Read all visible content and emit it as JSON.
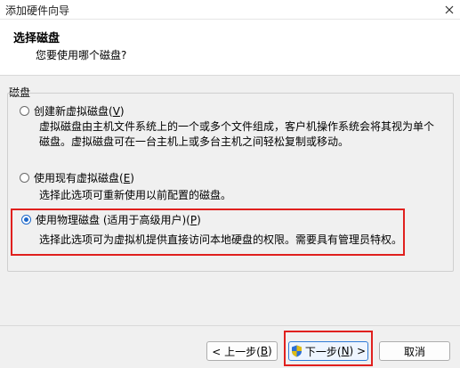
{
  "window": {
    "title": "添加硬件向导"
  },
  "header": {
    "title": "选择磁盘",
    "subtitle": "您要使用哪个磁盘?"
  },
  "group": {
    "label": "磁盘"
  },
  "options": [
    {
      "prefix": "创建新虚拟磁盘(",
      "key": "V",
      "suffix": ")",
      "desc_line1": "虚拟磁盘由主机文件系统上的一个或多个文件组成，客户机操作系统会将其视为单个",
      "desc_line2": "磁盘。虚拟磁盘可在一台主机上或多台主机之间轻松复制或移动。",
      "checked": false
    },
    {
      "prefix": "使用现有虚拟磁盘(",
      "key": "E",
      "suffix": ")",
      "desc_line1": "选择此选项可重新使用以前配置的磁盘。",
      "checked": false
    },
    {
      "prefix": "使用物理磁盘 (适用于高级用户)(",
      "key": "P",
      "suffix": ")",
      "desc_line1": "选择此选项可为虚拟机提供直接访问本地硬盘的权限。需要具有管理员特权。",
      "checked": true
    }
  ],
  "buttons": {
    "back": {
      "prefix": "< 上一步(",
      "key": "B",
      "suffix": ")"
    },
    "next": {
      "prefix": "下一步(",
      "key": "N",
      "suffix": ") >"
    },
    "cancel": "取消"
  },
  "colors": {
    "highlight": "#e0201e",
    "radio_checked": "#1a66c9"
  },
  "icons": {
    "close": "close-icon",
    "shield": "uac-shield-icon"
  }
}
